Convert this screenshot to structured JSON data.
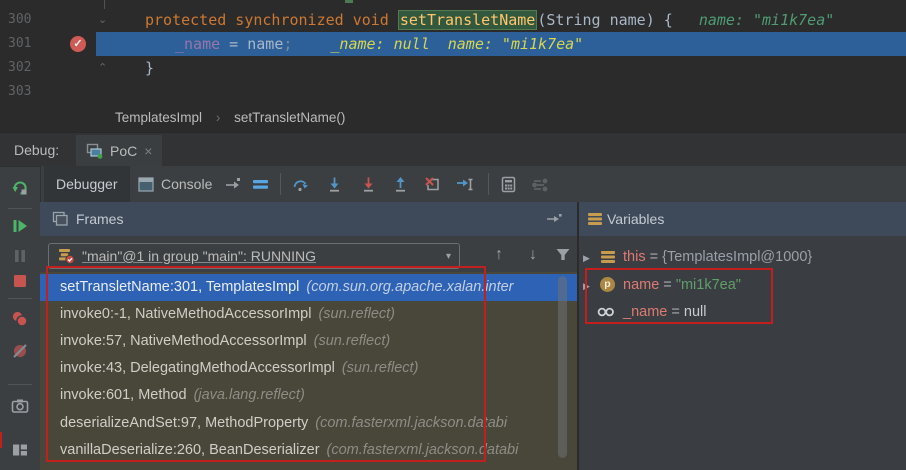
{
  "editor": {
    "line_numbers": [
      "300",
      "301",
      "302",
      "303"
    ],
    "line300": {
      "keywords": "protected synchronized void ",
      "method": "setTransletName",
      "rest": "(String name) {",
      "hint": "name: \"mi1k7ea\""
    },
    "line301": {
      "field": "_name",
      "op": " = ",
      "arg": "name",
      "semi": ";",
      "hint1": "_name: null",
      "hint2": "name: \"mi1k7ea\""
    },
    "line302": {
      "text": "}"
    },
    "breadcrumbs": {
      "class_name": "TemplatesImpl",
      "separator": "›",
      "method_name": "setTransletName()"
    }
  },
  "debug_window": {
    "label": "Debug:",
    "session_tab": {
      "title": "PoC",
      "close": "×"
    },
    "tabs": {
      "debugger": "Debugger",
      "console": "Console"
    }
  },
  "frames_panel": {
    "title": "Frames",
    "thread_selector": "\"main\"@1 in group \"main\": RUNNING",
    "dropdown_arrow": "▾",
    "up_arrow": "↑",
    "down_arrow": "↓",
    "rows": [
      {
        "location": "setTransletName:301, TemplatesImpl",
        "package": "(com.sun.org.apache.xalan.inter"
      },
      {
        "location": "invoke0:-1, NativeMethodAccessorImpl",
        "package": "(sun.reflect)"
      },
      {
        "location": "invoke:57, NativeMethodAccessorImpl",
        "package": "(sun.reflect)"
      },
      {
        "location": "invoke:43, DelegatingMethodAccessorImpl",
        "package": "(sun.reflect)"
      },
      {
        "location": "invoke:601, Method",
        "package": "(java.lang.reflect)"
      },
      {
        "location": "deserializeAndSet:97, MethodProperty",
        "package": "(com.fasterxml.jackson.databi"
      },
      {
        "location": "vanillaDeserialize:260, BeanDeserializer",
        "package": "(com.fasterxml.jackson.databi"
      }
    ]
  },
  "variables_panel": {
    "title": "Variables",
    "expand_arrow": "▶",
    "rows": [
      {
        "name": "this",
        "eq": " = ",
        "value": "{TemplatesImpl@1000}"
      },
      {
        "name": "name",
        "eq": " = ",
        "value": "\"mi1k7ea\""
      },
      {
        "name": "_name",
        "eq": " = ",
        "value": "null"
      }
    ],
    "param_icon_letter": "p"
  },
  "colors": {
    "annotation_red": "#c41f1f",
    "selection_blue": "#2d62b5",
    "current_line_blue": "#2d6099",
    "breakpoint_red": "#cf5b56",
    "string_green": "#5f9f68",
    "keyword_orange": "#cc7832"
  }
}
